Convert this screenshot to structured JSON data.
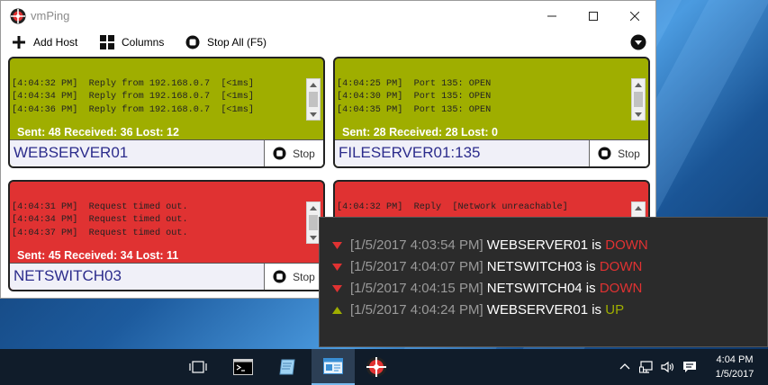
{
  "window": {
    "title": "vmPing"
  },
  "toolbar": {
    "add_host": "Add Host",
    "columns": "Columns",
    "stop_all": "Stop All (F5)"
  },
  "tiles": [
    {
      "status": "up",
      "log": [
        "[4:04:32 PM]  Reply from 192.168.0.7  [<1ms]",
        "[4:04:34 PM]  Reply from 192.168.0.7  [<1ms]",
        "[4:04:36 PM]  Reply from 192.168.0.7  [<1ms]"
      ],
      "stats": "Sent: 48 Received: 36 Lost: 12",
      "host": "WEBSERVER01",
      "stop_label": "Stop"
    },
    {
      "status": "up",
      "log": [
        "[4:04:25 PM]  Port 135: OPEN",
        "[4:04:30 PM]  Port 135: OPEN",
        "[4:04:35 PM]  Port 135: OPEN"
      ],
      "stats": "Sent: 28 Received: 28 Lost: 0",
      "host": "FILESERVER01:135",
      "stop_label": "Stop"
    },
    {
      "status": "down",
      "log": [
        "[4:04:31 PM]  Request timed out.",
        "[4:04:34 PM]  Request timed out.",
        "[4:04:37 PM]  Request timed out."
      ],
      "stats": "Sent: 45 Received: 34 Lost: 11",
      "host": "NETSWITCH03",
      "stop_label": "Stop"
    },
    {
      "status": "down",
      "log": [
        "[4:04:32 PM]  Reply  [Network unreachable]"
      ],
      "stats": "",
      "host": "",
      "stop_label": ""
    }
  ],
  "history": [
    {
      "direction": "down",
      "timestamp": "[1/5/2017 4:03:54 PM]",
      "host": "WEBSERVER01",
      "verb": "is",
      "status": "DOWN"
    },
    {
      "direction": "down",
      "timestamp": "[1/5/2017 4:04:07 PM]",
      "host": "NETSWITCH03",
      "verb": "is",
      "status": "DOWN"
    },
    {
      "direction": "down",
      "timestamp": "[1/5/2017 4:04:15 PM]",
      "host": "NETSWITCH04",
      "verb": "is",
      "status": "DOWN"
    },
    {
      "direction": "up",
      "timestamp": "[1/5/2017 4:04:24 PM]",
      "host": "WEBSERVER01",
      "verb": "is",
      "status": "UP"
    }
  ],
  "taskbar": {
    "clock_time": "4:04 PM",
    "clock_date": "1/5/2017"
  },
  "colors": {
    "up": "#9fae00",
    "down": "#e03232",
    "host_text": "#2c2c8c",
    "popup_bg": "#2b2b2b"
  },
  "icons": [
    "app-logo-icon",
    "minimize-icon",
    "maximize-icon",
    "close-icon",
    "plus-icon",
    "columns-icon",
    "stop-icon",
    "menu-chevron-icon",
    "task-view-icon",
    "terminal-icon",
    "notepad-icon",
    "vmping-icon",
    "chevron-up-icon",
    "network-icon",
    "volume-icon",
    "notifications-icon"
  ]
}
